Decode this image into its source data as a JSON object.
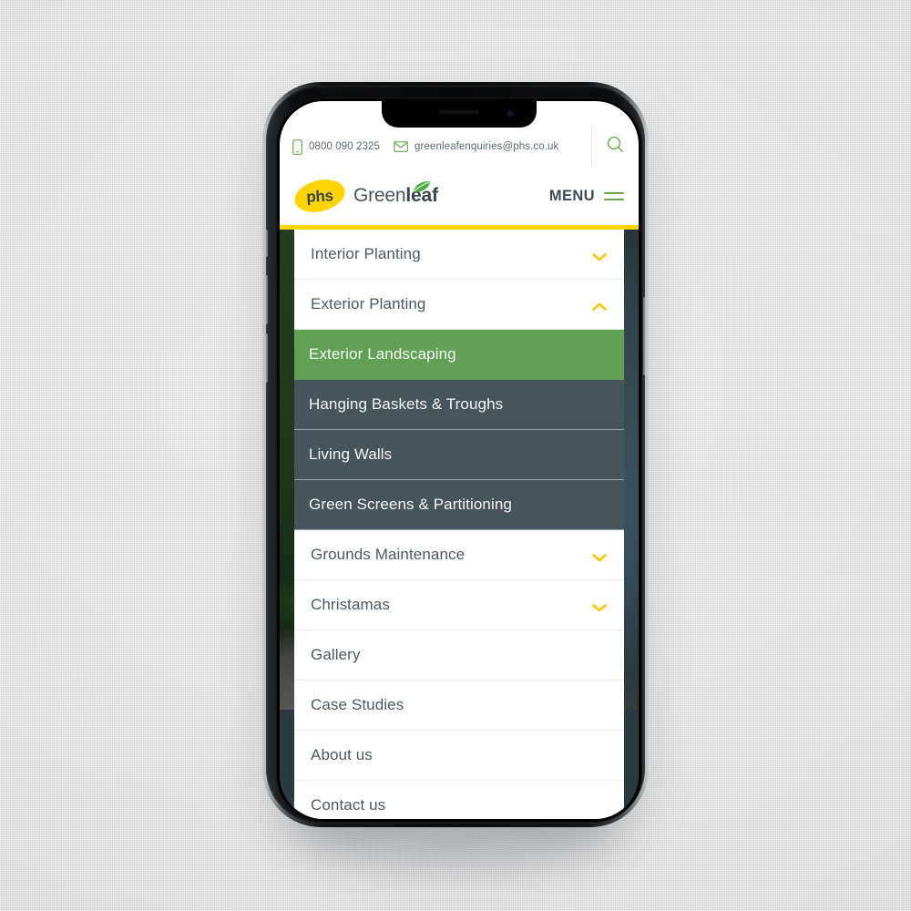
{
  "device": {
    "type": "smartphone-mockup",
    "frame_color": "#0a0b0c",
    "backdrop_color": "#dedede"
  },
  "site": {
    "brand": "phs Greenleaf",
    "accent_yellow": "#ffd400",
    "accent_green": "#61a055",
    "dark_slate": "#47545c"
  },
  "topbar": {
    "phone_icon": "mobile-phone-icon",
    "phone": "0800 090 2325",
    "email_icon": "envelope-icon",
    "email": "greenleafenquiries@phs.co.uk",
    "search_icon": "search-icon"
  },
  "header": {
    "logo_badge_text": "phs",
    "logo_word_light": "Green",
    "logo_word_bold": "leaf",
    "leaf_icon": "leaf-icon",
    "menu_label": "MENU",
    "menu_icon": "hamburger-icon"
  },
  "nav": {
    "items": [
      {
        "label": "Interior Planting",
        "level": 1,
        "state": "collapsed",
        "chevron": "chevron-down-icon"
      },
      {
        "label": "Exterior Planting",
        "level": 1,
        "state": "expanded",
        "chevron": "chevron-up-icon"
      },
      {
        "label": "Exterior Landscaping",
        "level": 2,
        "state": "active",
        "chevron": ""
      },
      {
        "label": "Hanging Baskets & Troughs",
        "level": 2,
        "state": "normal",
        "chevron": ""
      },
      {
        "label": "Living Walls",
        "level": 2,
        "state": "normal",
        "chevron": ""
      },
      {
        "label": "Green Screens & Partitioning",
        "level": 2,
        "state": "normal",
        "chevron": ""
      },
      {
        "label": "Grounds Maintenance",
        "level": 1,
        "state": "collapsed",
        "chevron": "chevron-down-icon"
      },
      {
        "label": "Christamas",
        "level": 1,
        "state": "collapsed",
        "chevron": "chevron-down-icon"
      },
      {
        "label": "Gallery",
        "level": 1,
        "state": "plain",
        "chevron": ""
      },
      {
        "label": "Case Studies",
        "level": 1,
        "state": "plain",
        "chevron": ""
      },
      {
        "label": "About us",
        "level": 1,
        "state": "plain",
        "chevron": ""
      },
      {
        "label": "Contact us",
        "level": 1,
        "state": "plain",
        "chevron": ""
      }
    ]
  },
  "footer_decoration": {
    "icon": "leaf-line-art-decoration"
  }
}
